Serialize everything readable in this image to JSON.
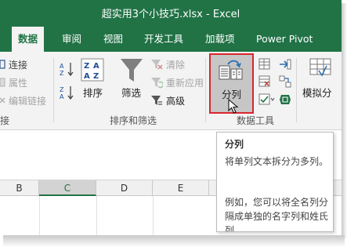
{
  "window": {
    "title": "超实用3个小技巧.xlsx  -  Excel"
  },
  "tabs": [
    {
      "label": "数据",
      "active": true
    },
    {
      "label": "审阅"
    },
    {
      "label": "视图"
    },
    {
      "label": "开发工具"
    },
    {
      "label": "加载项"
    },
    {
      "label": "Power Pivot"
    }
  ],
  "connections_group": {
    "items": [
      "连接",
      "属性",
      "编辑链接"
    ],
    "label": "接"
  },
  "sort_filter_group": {
    "sort_label": "排序",
    "filter_label": "筛选",
    "clear_label": "清除",
    "reapply_label": "重新应用",
    "advanced_label": "高级",
    "label": "排序和筛选"
  },
  "data_tools_group": {
    "text_to_columns_label": "分列",
    "label": "数据工具"
  },
  "forecast_group": {
    "what_if_label": "模拟分"
  },
  "columns": [
    "B",
    "C",
    "D",
    "E"
  ],
  "selected_column": "C",
  "tooltip": {
    "title": "分列",
    "description": "将单列文本拆分为多列。",
    "example": "例如，您可以将全名列分隔成单独的名字列和姓氏列。"
  },
  "colors": {
    "excel_green": "#217346",
    "highlight_red": "#d9262c",
    "filter_funnel": "#7f7f7f"
  }
}
